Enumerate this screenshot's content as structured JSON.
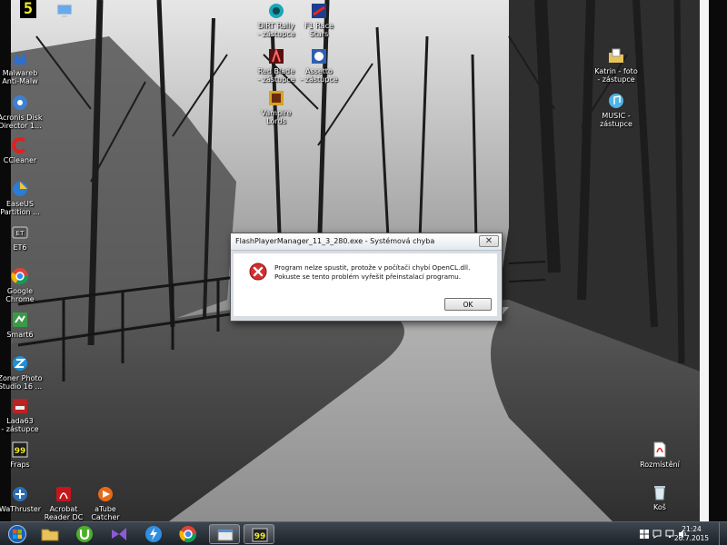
{
  "overlay_counter": "5",
  "desktop_icons": [
    {
      "id": "top-left-partial",
      "label": ""
    },
    {
      "id": "malwarebytes",
      "label": "Malwareb\nAnti-Malw"
    },
    {
      "id": "acronis",
      "label": "Acronis Disk\nDirector 1..."
    },
    {
      "id": "ccleaner",
      "label": "CCleaner"
    },
    {
      "id": "easeus",
      "label": "EaseUS\nPartition ..."
    },
    {
      "id": "et6",
      "label": "ET6"
    },
    {
      "id": "chrome",
      "label": "Google\nChrome"
    },
    {
      "id": "smart6",
      "label": "Smart6"
    },
    {
      "id": "zoner",
      "label": "Zoner Photo\nStudio 16 ..."
    },
    {
      "id": "lada",
      "label": "Lada63\n- zástupce"
    },
    {
      "id": "fraps",
      "label": "Fraps"
    },
    {
      "id": "wathruster",
      "label": "WaThruster"
    },
    {
      "id": "acrobat",
      "label": "Acrobat\nReader DC"
    },
    {
      "id": "atube",
      "label": "aTube\nCatcher"
    },
    {
      "id": "dirtrally",
      "label": "DiRT Rally\n- zástupce"
    },
    {
      "id": "f1race",
      "label": "F1 Race\nStars"
    },
    {
      "id": "game3",
      "label": "Red Blade\n- zástupce"
    },
    {
      "id": "game4",
      "label": "Assetto\n- zástupce"
    },
    {
      "id": "game5",
      "label": "Vampire\nLords"
    },
    {
      "id": "katrin",
      "label": "Katrin - foto\n- zástupce"
    },
    {
      "id": "music",
      "label": "MUSIC -\nzástupce"
    },
    {
      "id": "pdf",
      "label": "Rozmístění"
    },
    {
      "id": "recycle",
      "label": "Koš"
    }
  ],
  "dialog": {
    "title": "FlashPlayerManager_11_3_280.exe - Systémová chyba",
    "close_glyph": "✕",
    "message": "Program nelze spustit, protože v počítači chybí OpenCL.dll. Pokuste se tento problém vyřešit přeinstalací programu.",
    "ok_label": "OK"
  },
  "taskbar": {
    "pinned": [
      "start-orb",
      "explorer",
      "utorrent",
      "visual-studio",
      "network-app",
      "chrome",
      "window-app",
      "fraps-app"
    ],
    "clock_time": "21:24",
    "clock_date": "26.7.2015"
  },
  "colors": {
    "taskbar_bg": "#2b323a",
    "dialog_frame": "#d8dde3",
    "error_red": "#d32f2f",
    "counter_yellow": "#f2ee2a"
  }
}
